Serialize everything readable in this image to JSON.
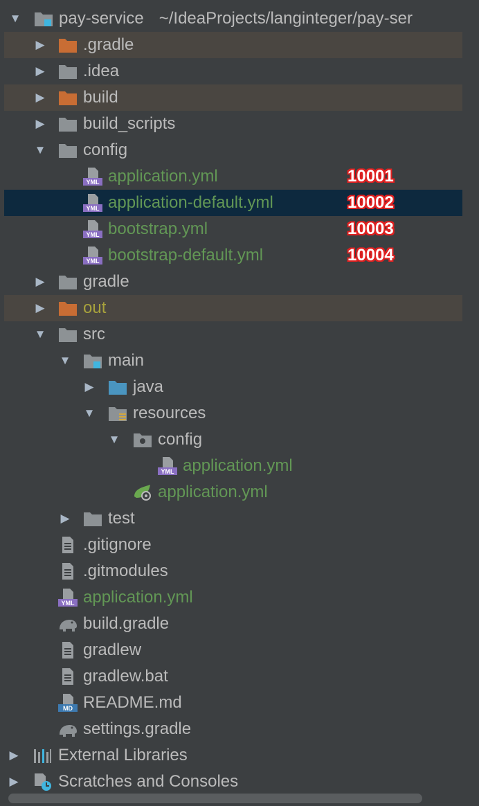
{
  "project": {
    "name": "pay-service",
    "path": "~/IdeaProjects/langinteger/pay-ser"
  },
  "rows": [
    {
      "label": "pay-service",
      "icon": "module-folder-icon",
      "arrow": "down"
    },
    {
      "label": ".gradle",
      "icon": "excluded-folder-icon",
      "arrow": "right"
    },
    {
      "label": ".idea",
      "icon": "folder-icon",
      "arrow": "right"
    },
    {
      "label": "build",
      "icon": "excluded-folder-icon",
      "arrow": "right"
    },
    {
      "label": "build_scripts",
      "icon": "folder-icon",
      "arrow": "right"
    },
    {
      "label": "config",
      "icon": "folder-icon",
      "arrow": "down"
    },
    {
      "label": "application.yml",
      "icon": "yml-file-icon",
      "badge": "10001"
    },
    {
      "label": "application-default.yml",
      "icon": "yml-file-icon",
      "badge": "10002"
    },
    {
      "label": "bootstrap.yml",
      "icon": "yml-file-icon",
      "badge": "10003"
    },
    {
      "label": "bootstrap-default.yml",
      "icon": "yml-file-icon",
      "badge": "10004"
    },
    {
      "label": "gradle",
      "icon": "folder-icon",
      "arrow": "right"
    },
    {
      "label": "out",
      "icon": "excluded-folder-icon",
      "arrow": "right"
    },
    {
      "label": "src",
      "icon": "folder-icon",
      "arrow": "down"
    },
    {
      "label": "main",
      "icon": "module-folder-icon",
      "arrow": "down"
    },
    {
      "label": "java",
      "icon": "source-folder-icon",
      "arrow": "right"
    },
    {
      "label": "resources",
      "icon": "resources-folder-icon",
      "arrow": "down"
    },
    {
      "label": "config",
      "icon": "package-folder-icon",
      "arrow": "down"
    },
    {
      "label": "application.yml",
      "icon": "yml-file-icon"
    },
    {
      "label": "application.yml",
      "icon": "spring-config-icon"
    },
    {
      "label": "test",
      "icon": "folder-icon",
      "arrow": "right"
    },
    {
      "label": ".gitignore",
      "icon": "text-file-icon"
    },
    {
      "label": ".gitmodules",
      "icon": "text-file-icon"
    },
    {
      "label": "application.yml",
      "icon": "yml-file-icon"
    },
    {
      "label": "build.gradle",
      "icon": "gradle-elephant-icon"
    },
    {
      "label": "gradlew",
      "icon": "text-file-icon"
    },
    {
      "label": "gradlew.bat",
      "icon": "text-file-icon"
    },
    {
      "label": "README.md",
      "icon": "markdown-file-icon"
    },
    {
      "label": "settings.gradle",
      "icon": "gradle-elephant-icon"
    },
    {
      "label": "External Libraries",
      "icon": "libraries-icon",
      "arrow": "right"
    },
    {
      "label": "Scratches and Consoles",
      "icon": "scratches-icon",
      "arrow": "right"
    }
  ],
  "colors": {
    "background": "#3c3f41",
    "selected": "#0d293e",
    "excluded": "#4a4641",
    "green_text": "#629755",
    "badge_red": "#e02020"
  }
}
